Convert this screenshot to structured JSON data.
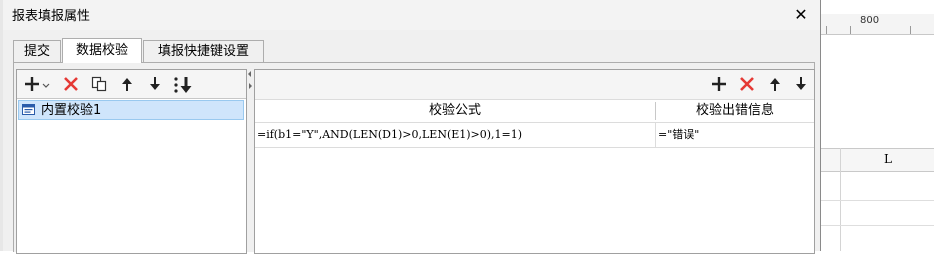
{
  "dialog": {
    "title": "报表填报属性",
    "close_symbol": "✕"
  },
  "tabs": [
    {
      "label": "提交",
      "active": false
    },
    {
      "label": "数据校验",
      "active": true
    },
    {
      "label": "填报快捷键设置",
      "active": false
    }
  ],
  "left_toolbar": {
    "icons": [
      "add-dropdown-icon",
      "delete-icon",
      "copy-icon",
      "move-up-icon",
      "move-down-icon",
      "sort-icon"
    ]
  },
  "validation_list": {
    "items": [
      {
        "label": "内置校验1",
        "selected": true
      }
    ]
  },
  "right_toolbar": {
    "icons": [
      "add-icon",
      "delete-icon",
      "move-up-icon",
      "move-down-icon"
    ]
  },
  "table": {
    "columns": [
      "校验公式",
      "校验出错信息"
    ],
    "rows": [
      {
        "formula": "=if(b1=\"Y\",AND(LEN(D1)>0,LEN(E1)>0),1=1)",
        "message": "=\"错误\""
      }
    ]
  },
  "background_sheet": {
    "ruler_label": "800",
    "column_label": "L"
  },
  "colors": {
    "delete_red": "#e53935",
    "selection_bg": "#cfe5fb",
    "selection_border": "#99c9ef",
    "icon_dark": "#222222"
  }
}
